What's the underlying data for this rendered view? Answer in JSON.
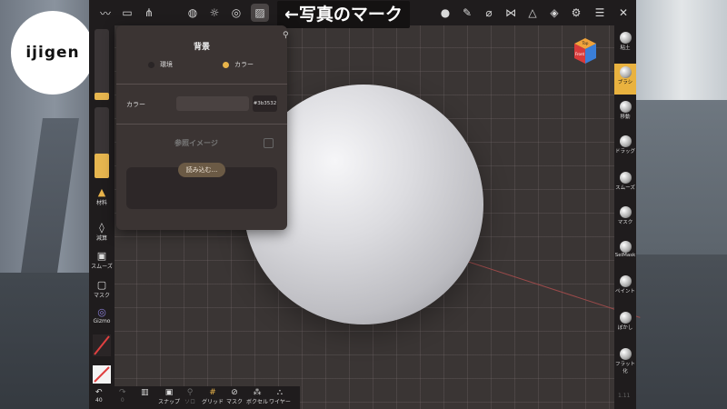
{
  "logo": {
    "text": "ijigen"
  },
  "annotation": {
    "text": "←写真のマーク"
  },
  "top_toolbar": {
    "icons": [
      "brush-stroke-icon",
      "folder-icon",
      "share-nodes-icon",
      "globe-icon",
      "sun-icon",
      "layers-icon",
      "photo-icon",
      "matcap-sphere-icon",
      "pen-icon",
      "dropper-icon",
      "mirror-icon",
      "wireframe-icon",
      "stack-icon",
      "settings-icon",
      "sliders-icon",
      "tools-icon"
    ]
  },
  "view_cube": {
    "top": "Top",
    "front": "Front"
  },
  "left_toolbar": {
    "material_label": "材料",
    "subtract_label": "減算",
    "smooth_label": "スムーズ",
    "mask_label": "マスク",
    "gizmo_label": "Gizmo",
    "radius_fraction": 0.1,
    "intensity_fraction": 0.35
  },
  "right_toolbar": {
    "items": [
      {
        "label": "粘土",
        "active": false
      },
      {
        "label": "ブラシ",
        "active": true
      },
      {
        "label": "移動",
        "active": false
      },
      {
        "label": "ドラッグ",
        "active": false
      },
      {
        "label": "スムーズ",
        "active": false
      },
      {
        "label": "マスク",
        "active": false
      },
      {
        "label": "SelMask",
        "active": false
      },
      {
        "label": "ペイント",
        "active": false
      },
      {
        "label": "ぼかし",
        "active": false
      },
      {
        "label": "フラット化",
        "active": false
      }
    ]
  },
  "bottom_toolbar": {
    "undo_label": "40",
    "redo_label": "0",
    "items": [
      {
        "label": "",
        "dim": false
      },
      {
        "label": "スナップ",
        "dim": false
      },
      {
        "label": "ソロ",
        "dim": true
      },
      {
        "label": "グリッド",
        "dim": false
      },
      {
        "label": "マスク",
        "dim": false
      },
      {
        "label": "ボクセル",
        "dim": false
      },
      {
        "label": "ワイヤー",
        "dim": false
      }
    ]
  },
  "panel": {
    "title": "背景",
    "option_env": "環境",
    "option_color": "カラー",
    "selected": "カラー",
    "color_label": "カラー",
    "color_hex": "#3b3532",
    "reference_label": "参照イメージ",
    "load_button": "読み込む..."
  },
  "frame_counter": "1.11"
}
